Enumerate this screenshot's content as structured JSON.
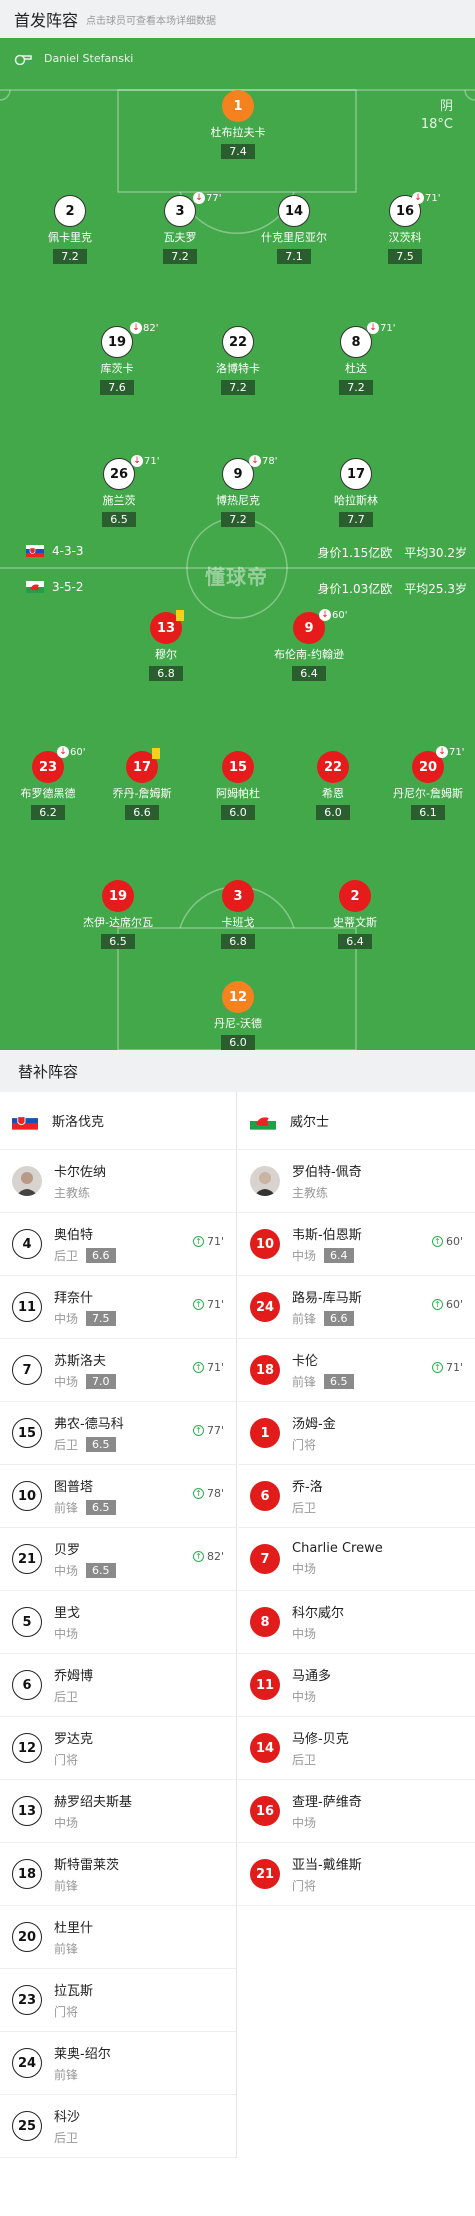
{
  "header": {
    "title": "首发阵容",
    "subtitle": "点击球员可查看本场详细数据"
  },
  "field": {
    "referee": "Daniel Stefanski",
    "weather": "阴",
    "temperature": "18°C",
    "watermark": "懂球帝",
    "home_formation": "4-3-3",
    "home_value": "身价1.15亿欧",
    "home_age": "平均30.2岁",
    "away_formation": "3-5-2",
    "away_value": "身价1.03亿欧",
    "away_age": "平均25.3岁"
  },
  "home_players": [
    {
      "num": "1",
      "name": "杜布拉夫卡",
      "rating": "7.4"
    },
    {
      "num": "2",
      "name": "佩卡里克",
      "rating": "7.2"
    },
    {
      "num": "3",
      "name": "瓦夫罗",
      "rating": "7.2",
      "sub": "77'"
    },
    {
      "num": "14",
      "name": "什克里尼亚尔",
      "rating": "7.1"
    },
    {
      "num": "16",
      "name": "汉茨科",
      "rating": "7.5",
      "sub": "71'"
    },
    {
      "num": "19",
      "name": "库茨卡",
      "rating": "7.6",
      "sub": "82'"
    },
    {
      "num": "22",
      "name": "洛博特卡",
      "rating": "7.2"
    },
    {
      "num": "8",
      "name": "杜达",
      "rating": "7.2",
      "sub": "71'"
    },
    {
      "num": "26",
      "name": "施兰茨",
      "rating": "6.5",
      "sub": "71'"
    },
    {
      "num": "9",
      "name": "博热尼克",
      "rating": "7.2",
      "sub": "78'"
    },
    {
      "num": "17",
      "name": "哈拉斯林",
      "rating": "7.7"
    }
  ],
  "away_players": [
    {
      "num": "13",
      "name": "穆尔",
      "rating": "6.8"
    },
    {
      "num": "9",
      "name": "布伦南-约翰逊",
      "rating": "6.4",
      "sub": "60'"
    },
    {
      "num": "23",
      "name": "布罗德黑德",
      "rating": "6.2",
      "sub": "60'"
    },
    {
      "num": "17",
      "name": "乔丹-詹姆斯",
      "rating": "6.6"
    },
    {
      "num": "15",
      "name": "阿姆帕杜",
      "rating": "6.0"
    },
    {
      "num": "22",
      "name": "希恩",
      "rating": "6.0"
    },
    {
      "num": "20",
      "name": "丹尼尔-詹姆斯",
      "rating": "6.1",
      "sub": "71'"
    },
    {
      "num": "19",
      "name": "杰伊-达席尔瓦",
      "rating": "6.5"
    },
    {
      "num": "3",
      "name": "卡班戈",
      "rating": "6.8"
    },
    {
      "num": "2",
      "name": "史蒂文斯",
      "rating": "6.4"
    },
    {
      "num": "12",
      "name": "丹尼-沃德",
      "rating": "6.0"
    }
  ],
  "bench": {
    "title": "替补阵容",
    "home_team": "斯洛伐克",
    "away_team": "威尔士",
    "home_coach": {
      "name": "卡尔佐纳",
      "role": "主教练"
    },
    "away_coach": {
      "name": "罗伯特-佩奇",
      "role": "主教练"
    },
    "home": [
      {
        "num": "4",
        "name": "奥伯特",
        "pos": "后卫",
        "rating": "6.6",
        "sub": "71'"
      },
      {
        "num": "11",
        "name": "拜奈什",
        "pos": "中场",
        "rating": "7.5",
        "sub": "71'"
      },
      {
        "num": "7",
        "name": "苏斯洛夫",
        "pos": "中场",
        "rating": "7.0",
        "sub": "71'"
      },
      {
        "num": "15",
        "name": "弗农-德马科",
        "pos": "后卫",
        "rating": "6.5",
        "sub": "77'"
      },
      {
        "num": "10",
        "name": "图普塔",
        "pos": "前锋",
        "rating": "6.5",
        "sub": "78'"
      },
      {
        "num": "21",
        "name": "贝罗",
        "pos": "中场",
        "rating": "6.5",
        "sub": "82'"
      },
      {
        "num": "5",
        "name": "里戈",
        "pos": "中场"
      },
      {
        "num": "6",
        "name": "乔姆博",
        "pos": "后卫"
      },
      {
        "num": "12",
        "name": "罗达克",
        "pos": "门将"
      },
      {
        "num": "13",
        "name": "赫罗绍夫斯基",
        "pos": "中场"
      },
      {
        "num": "18",
        "name": "斯特雷莱茨",
        "pos": "前锋"
      },
      {
        "num": "20",
        "name": "杜里什",
        "pos": "前锋"
      },
      {
        "num": "23",
        "name": "拉瓦斯",
        "pos": "门将"
      },
      {
        "num": "24",
        "name": "莱奥-绍尔",
        "pos": "前锋"
      },
      {
        "num": "25",
        "name": "科沙",
        "pos": "后卫"
      }
    ],
    "away": [
      {
        "num": "10",
        "name": "韦斯-伯恩斯",
        "pos": "中场",
        "rating": "6.4",
        "sub": "60'"
      },
      {
        "num": "24",
        "name": "路易-库马斯",
        "pos": "前锋",
        "rating": "6.6",
        "sub": "60'"
      },
      {
        "num": "18",
        "name": "卡伦",
        "pos": "前锋",
        "rating": "6.5",
        "sub": "71'"
      },
      {
        "num": "1",
        "name": "汤姆-金",
        "pos": "门将"
      },
      {
        "num": "6",
        "name": "乔-洛",
        "pos": "后卫"
      },
      {
        "num": "7",
        "name": "Charlie Crewe",
        "pos": "中场"
      },
      {
        "num": "8",
        "name": "科尔威尔",
        "pos": "中场"
      },
      {
        "num": "11",
        "name": "马通多",
        "pos": "中场"
      },
      {
        "num": "14",
        "name": "马修-贝克",
        "pos": "后卫"
      },
      {
        "num": "16",
        "name": "查理-萨维奇",
        "pos": "中场"
      },
      {
        "num": "21",
        "name": "亚当-戴维斯",
        "pos": "门将"
      }
    ]
  },
  "colors": {
    "pitch": "#43a84a",
    "home_circle": "#ffffff",
    "away_circle": "#e61b1b",
    "keeper": "#f5821f"
  }
}
